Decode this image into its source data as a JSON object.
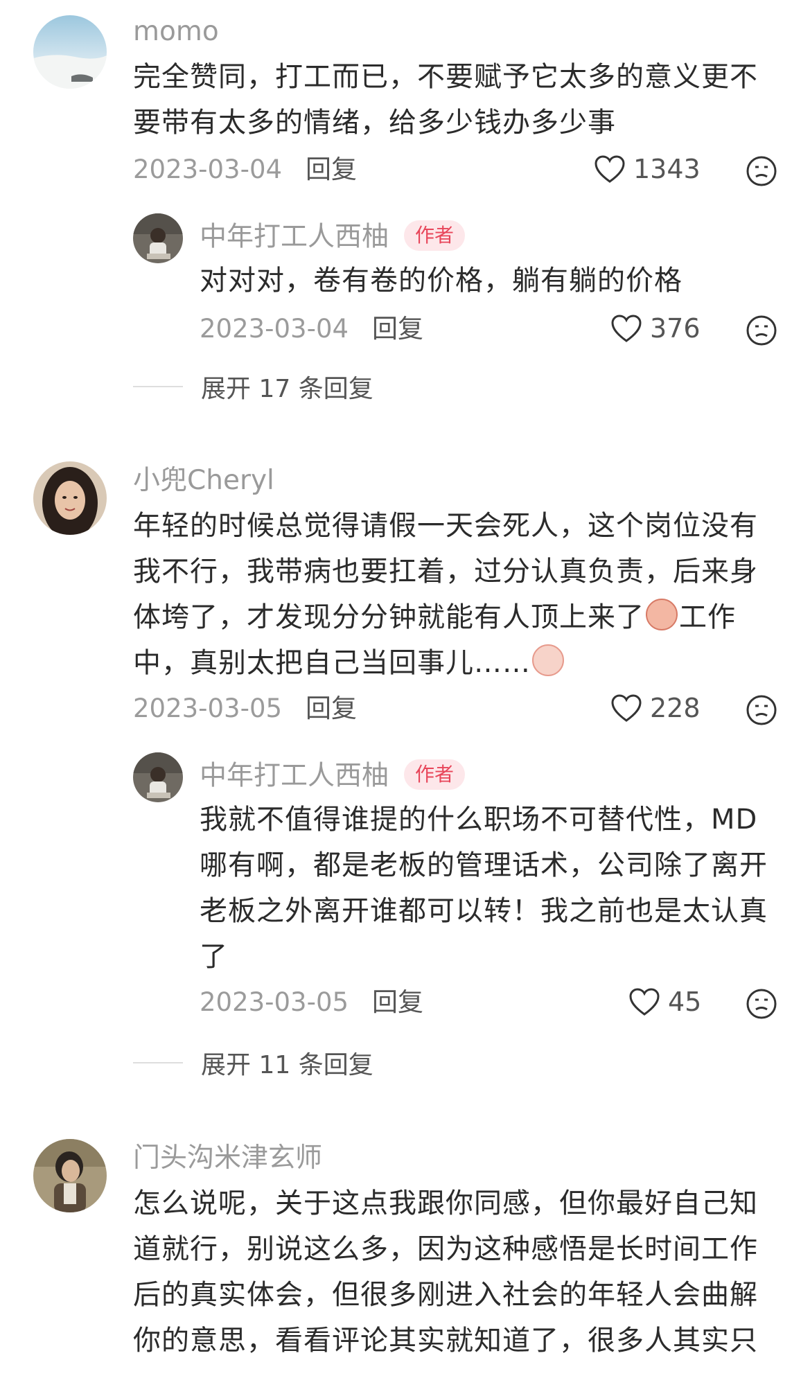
{
  "comments": [
    {
      "user": "momo",
      "text": "完全赞同，打工而已，不要赋予它太多的意义更不要带有太多的情绪，给多少钱办多少事",
      "date": "2023-03-04",
      "reply_label": "回复",
      "likes": "1343",
      "replies": [
        {
          "user": "中年打工人西柚",
          "badge": "作者",
          "text": "对对对，卷有卷的价格，躺有躺的价格",
          "date": "2023-03-04",
          "reply_label": "回复",
          "likes": "376"
        }
      ],
      "expand": "展开 17 条回复"
    },
    {
      "user": "小兜Cheryl",
      "text_part1": "年轻的时候总觉得请假一天会死人，这个岗位没有我不行，我带病也要扛着，过分认真负责，后来身体垮了，才发现分分钟就能有人顶上来了",
      "text_part2": "工作中，真别太把自己当回事儿……",
      "date": "2023-03-05",
      "reply_label": "回复",
      "likes": "228",
      "replies": [
        {
          "user": "中年打工人西柚",
          "badge": "作者",
          "text": "我就不值得谁提的什么职场不可替代性，MD哪有啊，都是老板的管理话术，公司除了离开老板之外离开谁都可以转！我之前也是太认真了",
          "date": "2023-03-05",
          "reply_label": "回复",
          "likes": "45"
        }
      ],
      "expand": "展开 11 条回复"
    },
    {
      "user": "门头沟米津玄师",
      "text": "怎么说呢，关于这点我跟你同感，但你最好自己知道就行，别说这么多，因为这种感悟是长时间工作后的真实体会，但很多刚进入社会的年轻人会曲解你的意思，看看评论其实就知道了，很多人其实只"
    }
  ],
  "colors": {
    "author_badge_bg": "#fde7ea",
    "author_badge_text": "#e8465a",
    "name_gray": "#9a9a9a"
  },
  "icons": [
    "heart-icon",
    "dislike-face-icon"
  ]
}
